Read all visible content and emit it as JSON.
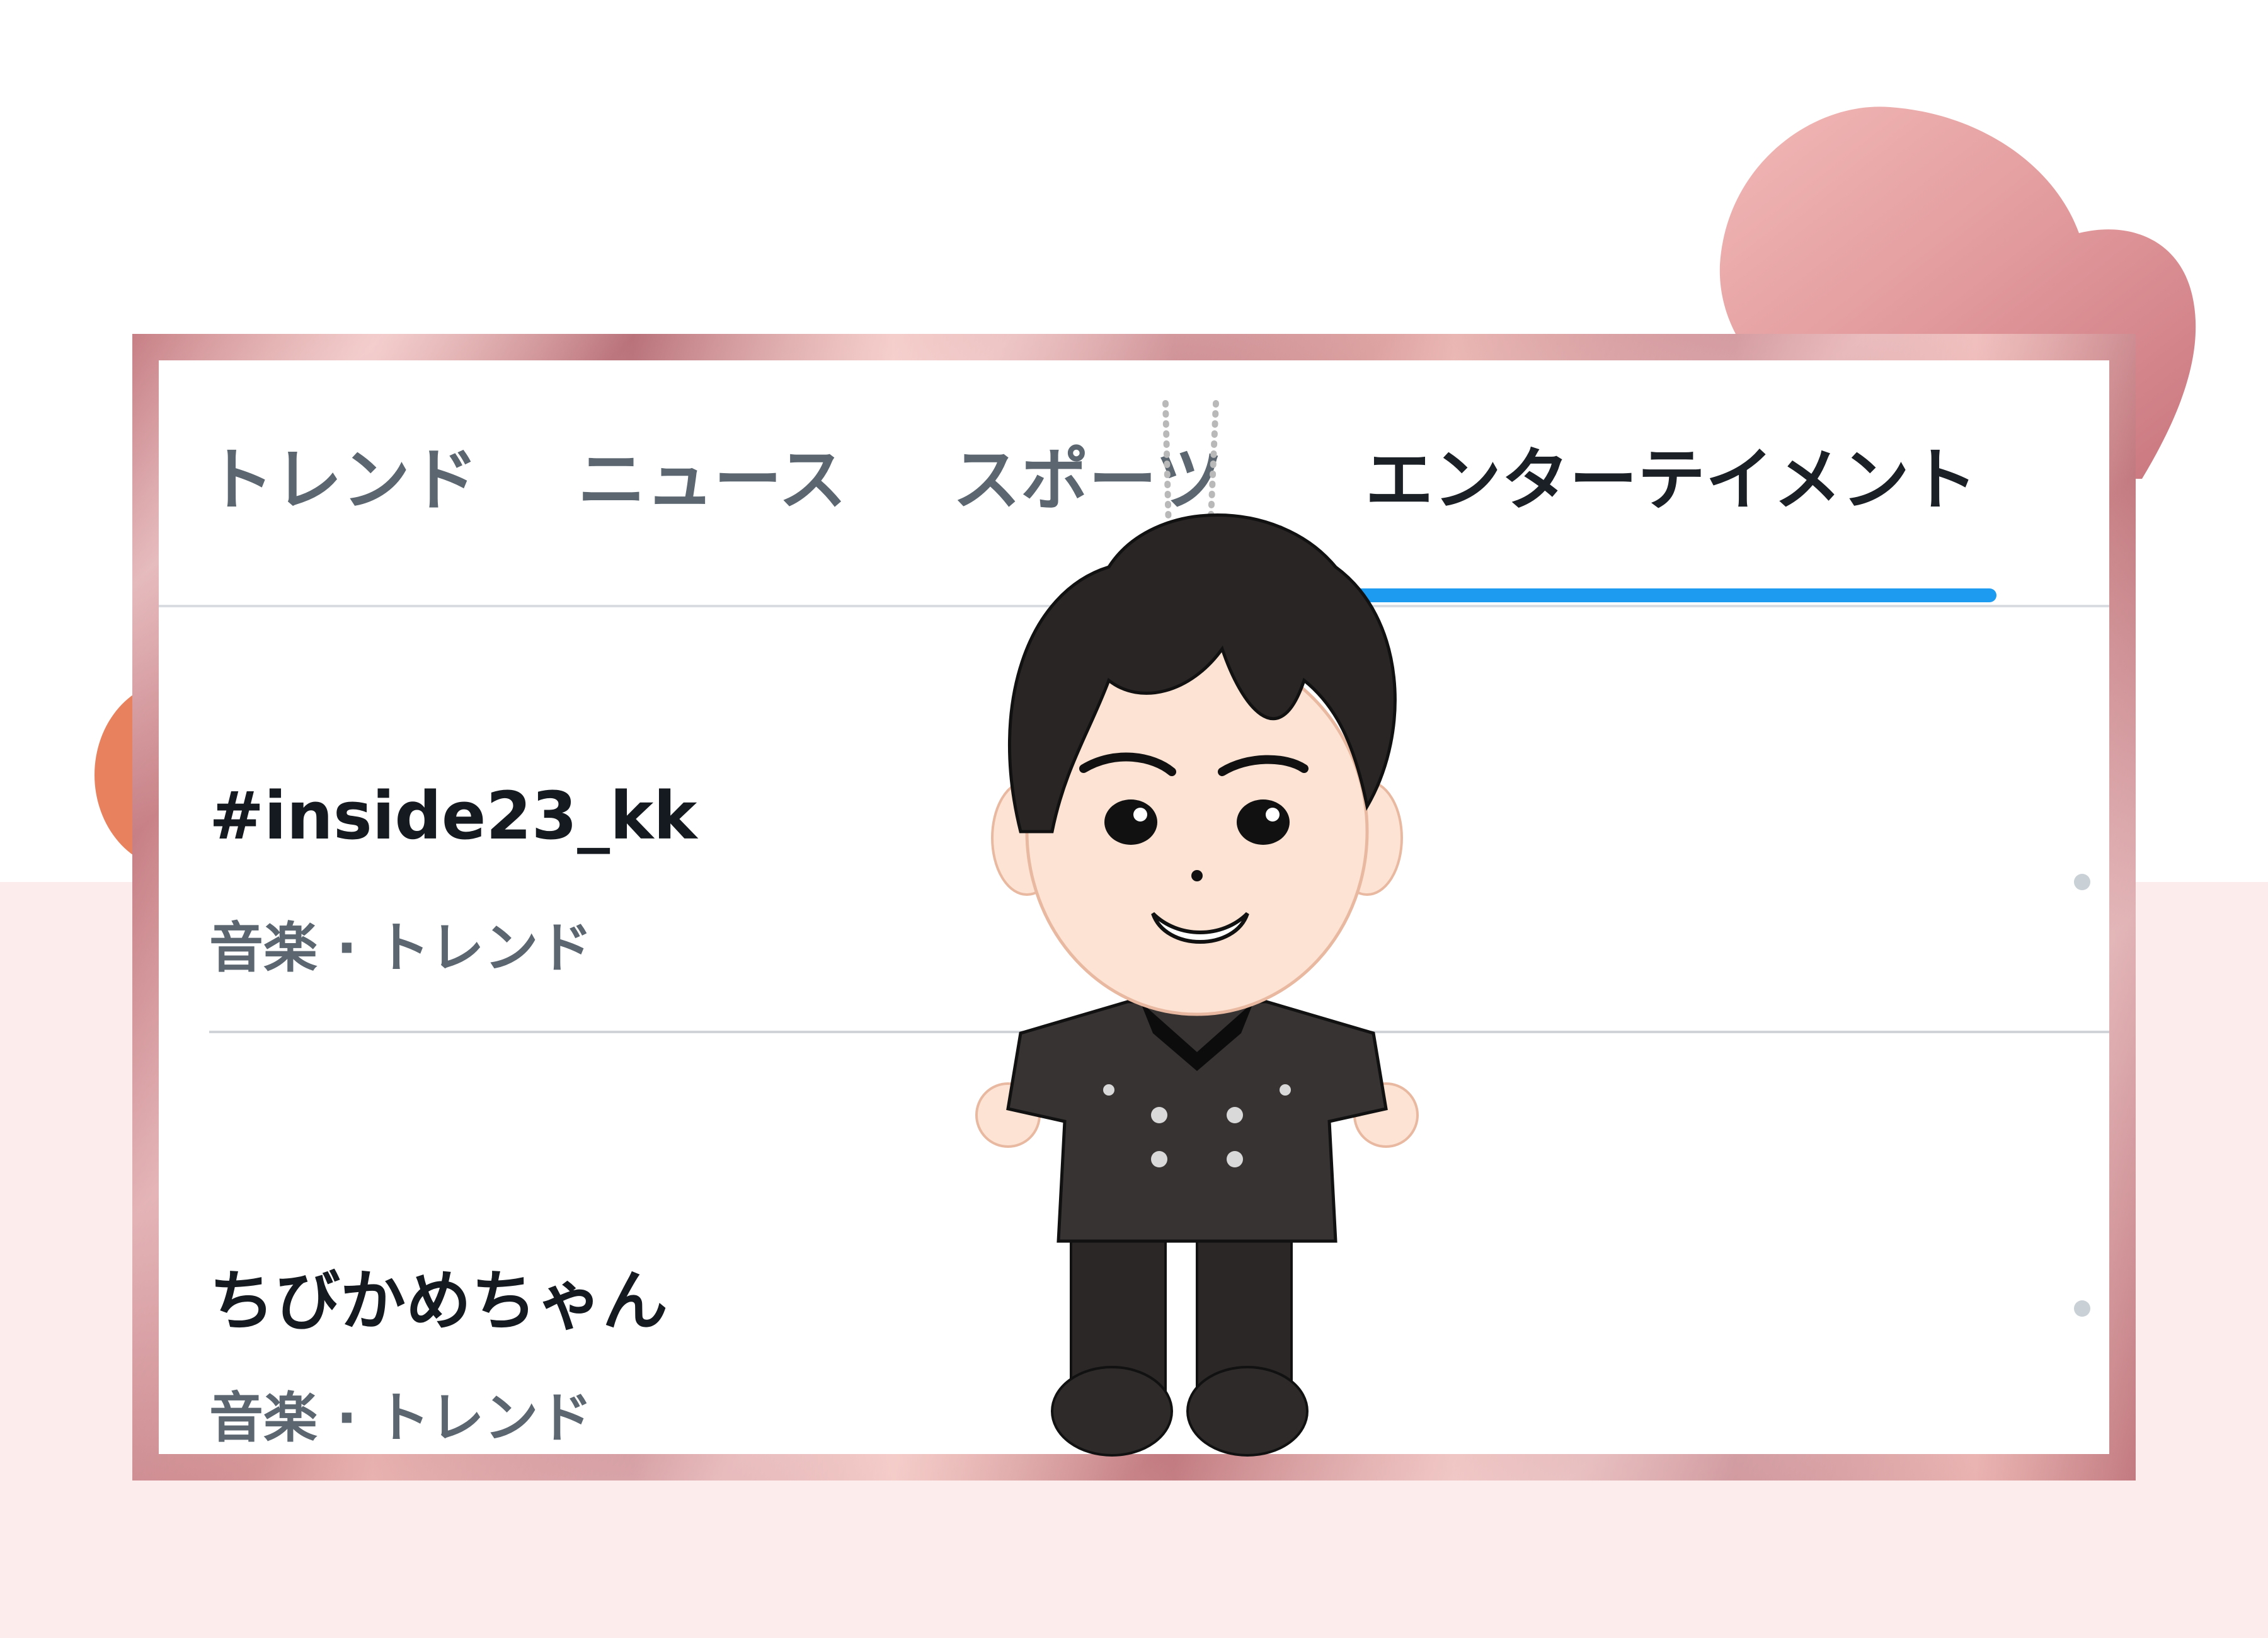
{
  "tabs": [
    {
      "label": "トレンド",
      "active": false
    },
    {
      "label": "ニュース",
      "active": false
    },
    {
      "label": "スポーツ",
      "active": false
    },
    {
      "label": "エンターテイメント",
      "active": true
    }
  ],
  "trends": [
    {
      "title": "#inside23_kk",
      "meta": "音楽 · トレンド"
    },
    {
      "title": "ちびかめちゃん",
      "meta": "音楽 · トレンド"
    }
  ],
  "colors": {
    "accent": "#1d9bf0",
    "frame": "#c67f85",
    "background_lower": "#fdecec"
  },
  "icons": {
    "more": "more-dot-icon",
    "decoration_heart": "heart-icon",
    "mascot": "chibi-mascot-keychain"
  }
}
